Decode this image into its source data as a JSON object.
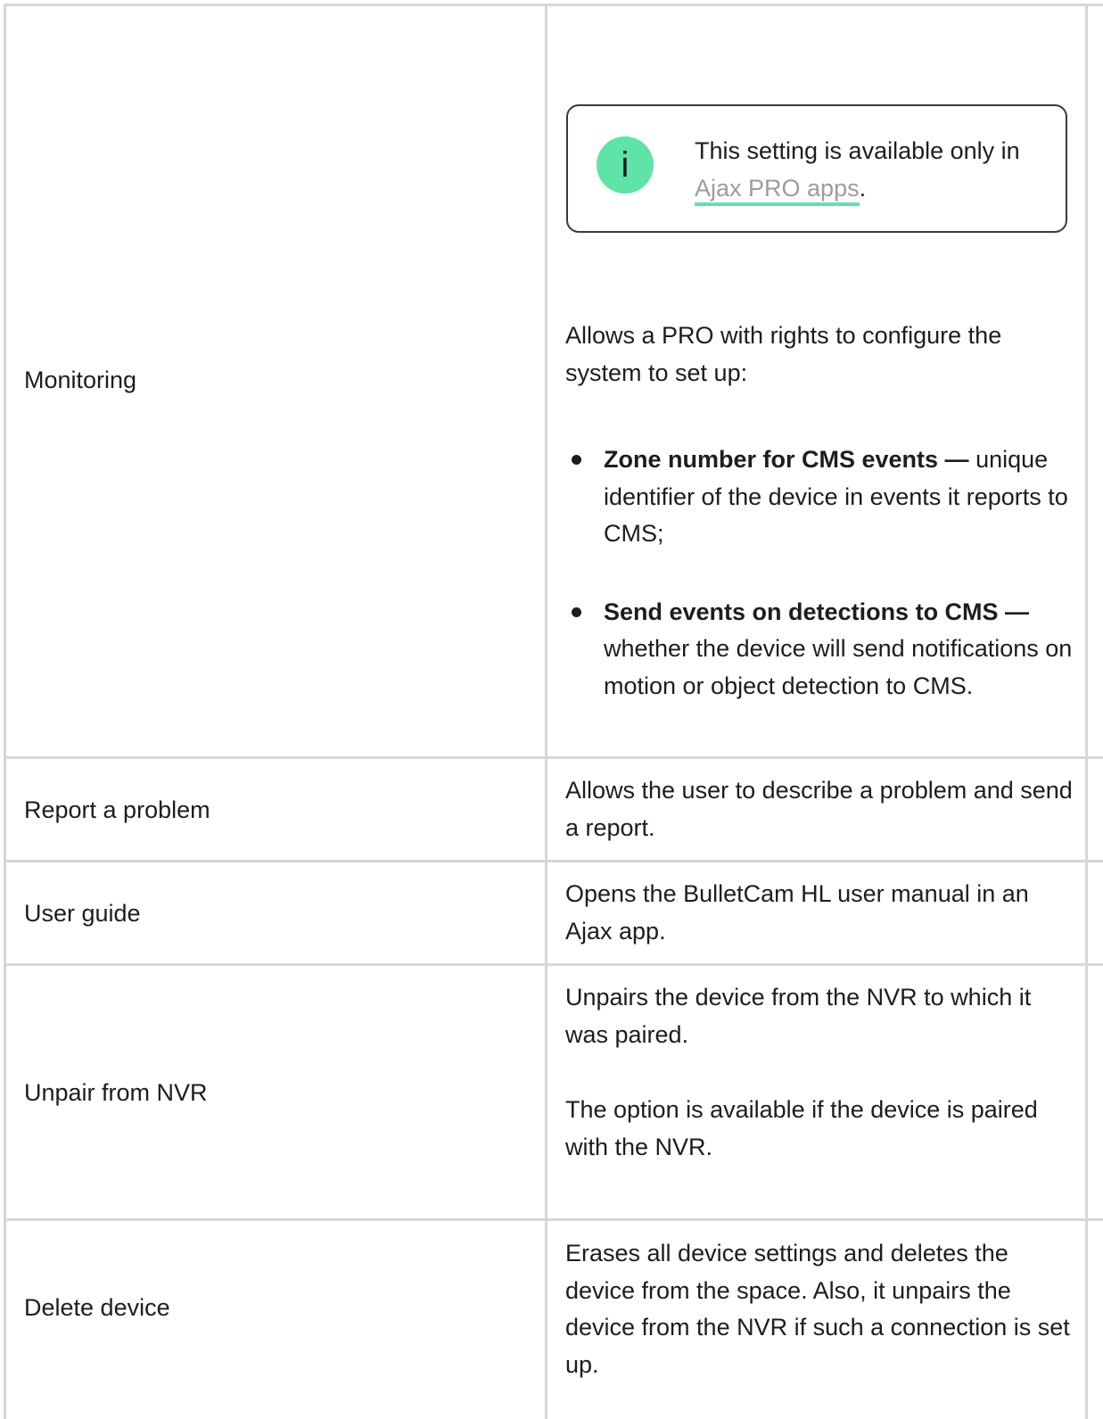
{
  "rows": [
    {
      "name": "Monitoring",
      "note": {
        "text": "This setting is available only in",
        "link": "Ajax PRO apps",
        "suffix": "."
      },
      "intro": "Allows a PRO with rights to configure the system to set up:",
      "bullets": [
        {
          "term": "Zone number for CMS events —",
          "desc": " unique identifier of the device in events it reports to CMS;"
        },
        {
          "term": "Send events on detections to CMS —",
          "desc": " whether the device will send notifications on motion or object detection to CMS."
        }
      ]
    },
    {
      "name": "Report a problem",
      "desc": "Allows the user to describe a problem and send a report."
    },
    {
      "name": "User guide",
      "desc": "Opens the BulletCam HL user manual in an Ajax app."
    },
    {
      "name": "Unpair from NVR",
      "desc": "Unpairs the device from the NVR to which it was paired.",
      "desc2": "The option is available if the device is paired with the NVR."
    },
    {
      "name": "Delete device",
      "desc": "Erases all device settings and deletes the device from the space. Also, it unpairs the device from the NVR if such a connection is set up."
    }
  ],
  "colors": {
    "border": "#d6d6d6",
    "accent": "#5ee4a6",
    "link": "#9c9c9c",
    "text": "#1d1d1f"
  },
  "icons": {
    "note": "info-icon"
  }
}
